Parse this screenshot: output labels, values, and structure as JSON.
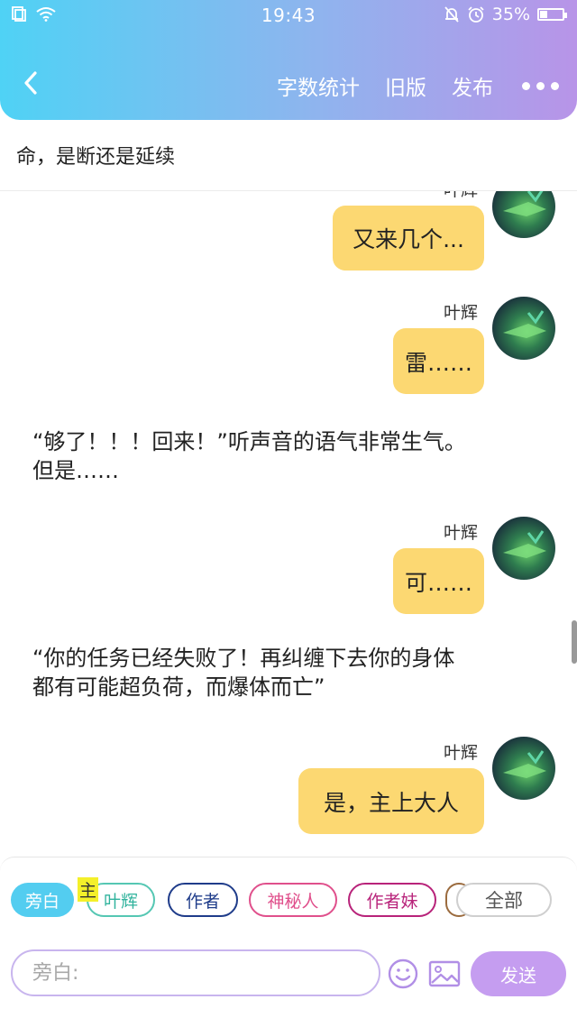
{
  "status_bar": {
    "time": "19:43",
    "battery": "35%",
    "battery_level": 0.35
  },
  "nav": {
    "word_count": "字数统计",
    "old_version": "旧版",
    "publish": "发布"
  },
  "chapter": {
    "title": "命，是断还是延续"
  },
  "messages": [
    {
      "type": "character",
      "speaker": "叶辉",
      "text": "又来几个..."
    },
    {
      "type": "character",
      "speaker": "叶辉",
      "text": "雷……"
    },
    {
      "type": "narration",
      "lines": [
        "“够了！！！回来！”听声音的语气非常生气。",
        "但是……"
      ]
    },
    {
      "type": "character",
      "speaker": "叶辉",
      "text": "可……"
    },
    {
      "type": "narration",
      "lines": [
        "“你的任务已经失败了！再纠缠下去你的身体",
        "都有可能超负荷，而爆体而亡”"
      ]
    },
    {
      "type": "character",
      "speaker": "叶辉",
      "text": "是，主上大人"
    }
  ],
  "roles": {
    "narration": "旁白",
    "ye_hui": "叶辉",
    "author": "作者",
    "mystery": "神秘人",
    "author_sister": "作者妹",
    "all": "全部",
    "highlight": "主"
  },
  "composer": {
    "placeholder": "旁白:",
    "send": "发送"
  },
  "colors": {
    "header_gradient_start": "#4fd2f5",
    "header_gradient_end": "#b894e8",
    "bubble": "#fcd872",
    "send_button": "#c59df0",
    "narration_chip": "#53cdf0"
  }
}
